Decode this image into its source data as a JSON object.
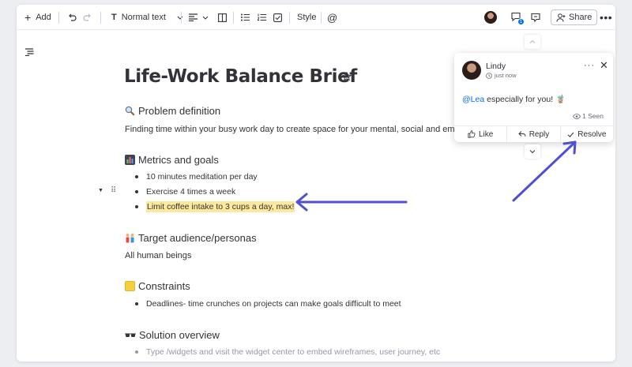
{
  "toolbar": {
    "add_label": "Add",
    "text_style": "Normal text",
    "style_label": "Style",
    "notification_count": "1",
    "share_label": "Share"
  },
  "document": {
    "title": "Life-Work Balance Brief",
    "sections": [
      {
        "emoji": "magnifier-icon",
        "heading": "Problem definition",
        "text": "Finding time within your busy work day to create space for your mental, social and emotional w"
      },
      {
        "emoji": "chart-icon",
        "heading": "Metrics and goals",
        "items": [
          "10 minutes meditation per day",
          "Exercise 4 times a week",
          "Limit coffee intake to 3 cups a day, max!"
        ]
      },
      {
        "emoji": "people-icon",
        "heading": "Target audience/personas",
        "text": "All human beings"
      },
      {
        "emoji": "note-icon",
        "heading": "Constraints",
        "items": [
          "Deadlines- time crunches on projects can make goals difficult to meet"
        ]
      },
      {
        "emoji": "glasses-icon",
        "heading": "Solution overview",
        "placeholder": "Type /widgets and visit the widget center to embed wireframes, user journey, etc"
      }
    ]
  },
  "comment": {
    "author": "Lindy",
    "time": "just now",
    "mention": "@Lea",
    "message": " especially for you! 🧋",
    "seen": "1 Seen",
    "actions": {
      "like": "Like",
      "reply": "Reply",
      "resolve": "Resolve"
    }
  },
  "colors": {
    "accent": "#0073ea",
    "highlight": "#fde99b",
    "annotation_arrow": "#4f4fd6"
  }
}
